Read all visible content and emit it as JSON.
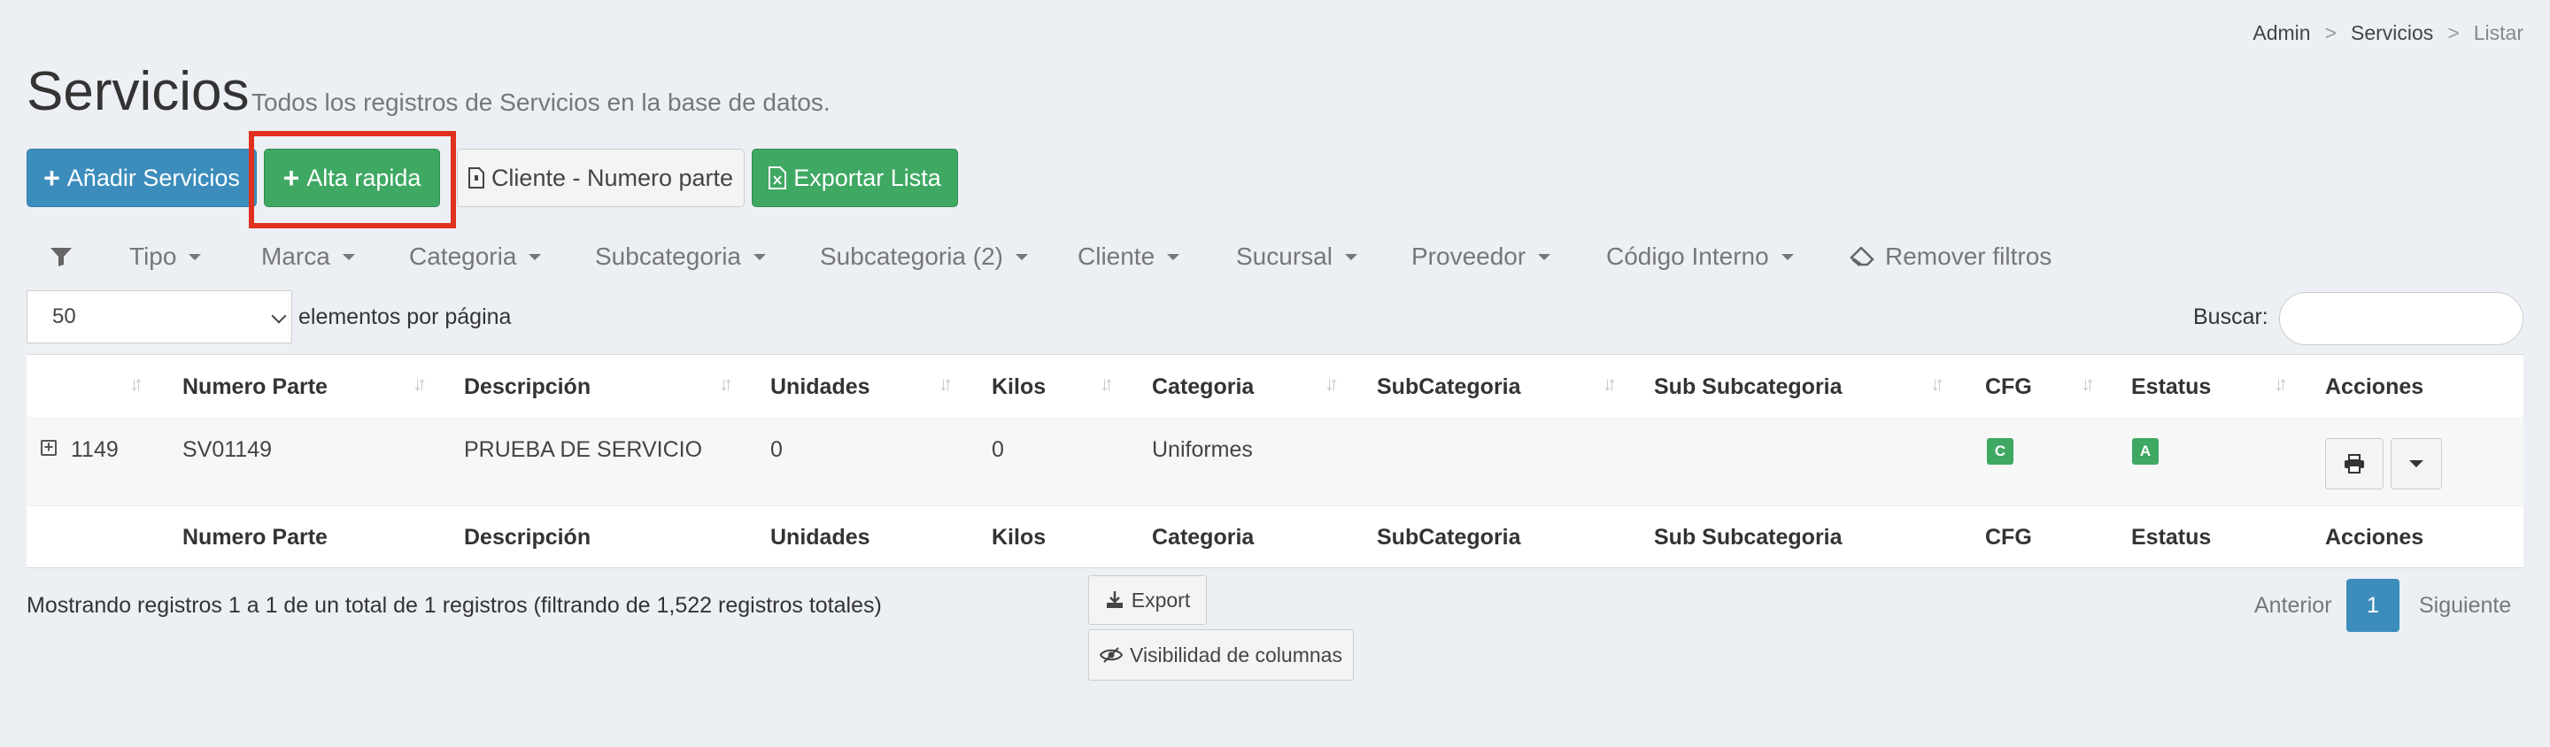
{
  "breadcrumb": {
    "items": [
      "Admin",
      "Servicios",
      "Listar"
    ],
    "separator": ">"
  },
  "header": {
    "title": "Servicios",
    "subtitle": "Todos los registros de Servicios en la base de datos."
  },
  "actions": {
    "add": "Añadir Servicios",
    "quick_add": "Alta rapida",
    "client_part": "Cliente - Numero parte",
    "export_list": "Exportar Lista"
  },
  "filters": {
    "items": [
      "Tipo",
      "Marca",
      "Categoria",
      "Subcategoria",
      "Subcategoria (2)",
      "Cliente",
      "Sucursal",
      "Proveedor",
      "Código Interno"
    ],
    "clear": "Remover filtros"
  },
  "pagination": {
    "page_size": "50",
    "page_size_label": "elementos por página",
    "search_label": "Buscar:",
    "search_value": ""
  },
  "table": {
    "columns": [
      "Numero Parte",
      "Descripción",
      "Unidades",
      "Kilos",
      "Categoria",
      "SubCategoria",
      "Sub Subcategoria",
      "CFG",
      "Estatus",
      "Acciones"
    ],
    "rows": [
      {
        "id": "1149",
        "numero_parte": "SV01149",
        "descripcion": "PRUEBA DE SERVICIO",
        "unidades": "0",
        "kilos": "0",
        "categoria": "Uniformes",
        "subcategoria": "",
        "sub_subcategoria": "",
        "cfg": "C",
        "estatus": "A"
      }
    ]
  },
  "footer": {
    "info": "Mostrando registros 1 a 1 de un total de 1 registros (filtrando de 1,522 registros totales)",
    "export": "Export",
    "visibility": "Visibilidad de columnas",
    "prev": "Anterior",
    "current_page": "1",
    "next": "Siguiente"
  },
  "colors": {
    "primary": "#3c8dbc",
    "success": "#3fa863",
    "highlight": "#e0301e",
    "background": "#ecf0f5"
  }
}
